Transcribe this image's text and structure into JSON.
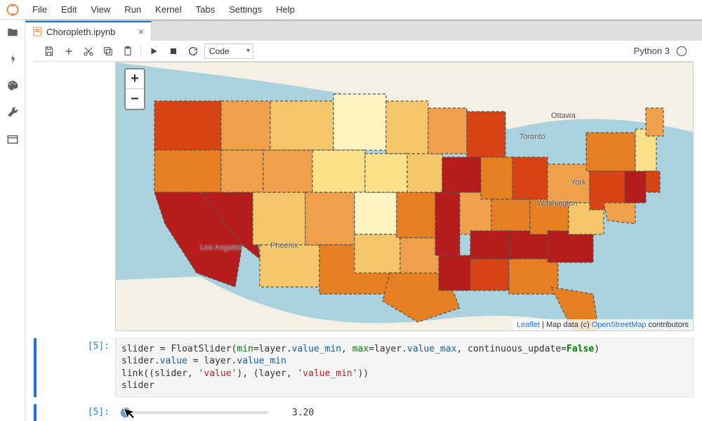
{
  "menu": {
    "items": [
      "File",
      "Edit",
      "View",
      "Run",
      "Kernel",
      "Tabs",
      "Settings",
      "Help"
    ]
  },
  "tab": {
    "title": "Choropleth.ipynb",
    "close": "×"
  },
  "toolbar": {
    "celltype": "Code",
    "kernel": "Python 3"
  },
  "map": {
    "zoom_in": "+",
    "zoom_out": "−",
    "labels": {
      "los_angeles": "Los Angeles",
      "phoenix": "Phoenix",
      "toronto": "Toronto",
      "ottawa": "Ottawa",
      "new_york": "York",
      "washington": "Washington"
    },
    "attrib": {
      "leaflet": "Leaflet",
      "sep": " | Map data (c) ",
      "osm": "OpenStreetMap",
      "tail": " contributors"
    }
  },
  "cells": {
    "c5": {
      "prompt": "[5]:",
      "code_tokens": [
        [
          "",
          "slider "
        ],
        [
          "",
          "= "
        ],
        [
          "",
          "FloatSlider("
        ],
        [
          "builtin",
          "min"
        ],
        [
          "",
          "=layer."
        ],
        [
          "attr",
          "value_min"
        ],
        [
          "",
          ", "
        ],
        [
          "builtin",
          "max"
        ],
        [
          "",
          "=layer."
        ],
        [
          "attr",
          "value_max"
        ],
        [
          "",
          ", continuous_update="
        ],
        [
          "bool",
          "False"
        ],
        [
          "",
          ")\n"
        ],
        [
          "",
          "slider."
        ],
        [
          "attr",
          "value"
        ],
        [
          "",
          " = layer."
        ],
        [
          "attr",
          "value_min"
        ],
        [
          "",
          "\n"
        ],
        [
          "",
          "link((slider, "
        ],
        [
          "str",
          "'value'"
        ],
        [
          "",
          ")"
        ],
        [
          "",
          ", (layer, "
        ],
        [
          "str",
          "'value_min'"
        ],
        [
          "",
          ")"
        ],
        [
          "",
          "\n"
        ],
        [
          "",
          "slider"
        ]
      ],
      "code_plain": "slider = FloatSlider(min=layer.value_min, max=layer.value_max, continuous_update=False)\nslider.value = layer.value_min\nlink((slider, 'value'), (layer, 'value_min'))\nslider"
    },
    "out5": {
      "prompt": "[5]:",
      "value": "3.20"
    }
  },
  "colors": {
    "c1": "#b71c1c",
    "c2": "#d84315",
    "c3": "#e67e22",
    "c4": "#f0a04b",
    "c5": "#f6c76a",
    "c6": "#fde08a",
    "c7": "#fff4c2",
    "water": "#aad3df",
    "land": "#f5f0e6"
  }
}
